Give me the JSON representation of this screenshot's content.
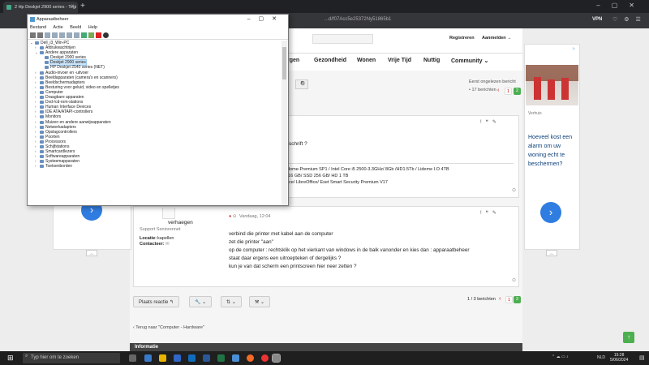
{
  "browser": {
    "tab_title": "2 Hp Deskjet 2900 series - Tegi",
    "url": "...d/f07Acc5e25372Ny51865b1",
    "vpn_label": "VPN"
  },
  "header": {
    "register": "Registreren",
    "login": "Aanmelden →"
  },
  "nav": {
    "items": [
      "rgen",
      "Gezondheid",
      "Wonen",
      "Vrije Tijd",
      "Nuttig",
      "Community ⌄"
    ]
  },
  "topic_meta": {
    "line1": "Eerst ongelezen bericht",
    "line2": "• 17 berichten",
    "pages": [
      "1",
      "2"
    ]
  },
  "post1": {
    "question": "nderschrift ?",
    "specs": [
      "N 7 Home-Premium SP1 / Intel Core i5 2500-3.3GHz/ 8Gb /HD1.5Tb / Lideme I.O 4TB",
      "1/7 / 16 GB/ SSD 256 GB/ HD 1 TB",
      "mOffice/ LibreOffice/ Eset Smart Security Premium V17"
    ]
  },
  "post2": {
    "author": "verhaegen",
    "role": "Support Seniorennet",
    "location_label": "Locatie:",
    "location_value": "kapellen",
    "contact_label": "Contacteer:",
    "timestamp": "Vandaag, 12:04",
    "lines": [
      "verbind die printer met kabel aan de computer",
      "zet die printer \"aan\"",
      "op de computer : rechtsklik op het vierkant van windows in de balk vanonder en kies dan : apparaatbeheer",
      "staat daar ergens een uitroepteken of dergelijks ?",
      "kun je van dat scherm een printscreen hier neer zetten ?"
    ]
  },
  "footer_tools": {
    "reply": "Plaats reactie ↰",
    "count": "1 / 3 berichten",
    "pages": [
      "1",
      "2"
    ],
    "back": "‹ Terug naar \"Computer - Hardware\""
  },
  "info_bar": "Informatie",
  "ad_right": {
    "source": "Verhuis",
    "text": "Hoeveel kost een alarm om uw woning echt te beschermen?"
  },
  "device_manager": {
    "title": "Apparaatbeheer",
    "menu": [
      "Bestand",
      "Actie",
      "Beeld",
      "Help"
    ],
    "tree": [
      {
        "level": 0,
        "exp": "⌄",
        "label": "Dell_i3_Win-PC"
      },
      {
        "level": 1,
        "exp": "›",
        "label": "Afdrukwachtrijen"
      },
      {
        "level": 1,
        "exp": "⌄",
        "label": "Andere apparaten"
      },
      {
        "level": 2,
        "exp": "",
        "label": "Deskjet 2900 series"
      },
      {
        "level": 2,
        "exp": "",
        "label": "Deskjet 2900 series",
        "selected": true
      },
      {
        "level": 2,
        "exp": "",
        "label": "HP Deskjet 2540 series (NET)"
      },
      {
        "level": 1,
        "exp": "›",
        "label": "Audio-invoer en -uitvoer"
      },
      {
        "level": 1,
        "exp": "›",
        "label": "Beeldapparaten (camera's en scanners)"
      },
      {
        "level": 1,
        "exp": "›",
        "label": "Beeldschermadapters"
      },
      {
        "level": 1,
        "exp": "›",
        "label": "Besturing voor geluid, video en spelletjes"
      },
      {
        "level": 1,
        "exp": "›",
        "label": "Computer"
      },
      {
        "level": 1,
        "exp": "›",
        "label": "Draagbare apparaten"
      },
      {
        "level": 1,
        "exp": "›",
        "label": "Dvd-/cd-rom-stations"
      },
      {
        "level": 1,
        "exp": "›",
        "label": "Human Interface Devices"
      },
      {
        "level": 1,
        "exp": "›",
        "label": "IDE ATA/ATAPI-controllers"
      },
      {
        "level": 1,
        "exp": "›",
        "label": "Monitors"
      },
      {
        "level": 1,
        "exp": "›",
        "label": "Muizen en andere aanwijsapparaten"
      },
      {
        "level": 1,
        "exp": "›",
        "label": "Netwerkadapters"
      },
      {
        "level": 1,
        "exp": "›",
        "label": "Opslagcontrollers"
      },
      {
        "level": 1,
        "exp": "›",
        "label": "Poorten"
      },
      {
        "level": 1,
        "exp": "›",
        "label": "Processors"
      },
      {
        "level": 1,
        "exp": "›",
        "label": "Schijfstations"
      },
      {
        "level": 1,
        "exp": "›",
        "label": "Smartcardlezers"
      },
      {
        "level": 1,
        "exp": "›",
        "label": "Softwareapparaten"
      },
      {
        "level": 1,
        "exp": "›",
        "label": "Systeemapparaten"
      },
      {
        "level": 1,
        "exp": "›",
        "label": "Toetsenborden"
      }
    ]
  },
  "taskbar": {
    "search_placeholder": "Typ hier om te zoeken",
    "lang": "NLD",
    "time": "15:28",
    "date": "5/06/2024"
  }
}
